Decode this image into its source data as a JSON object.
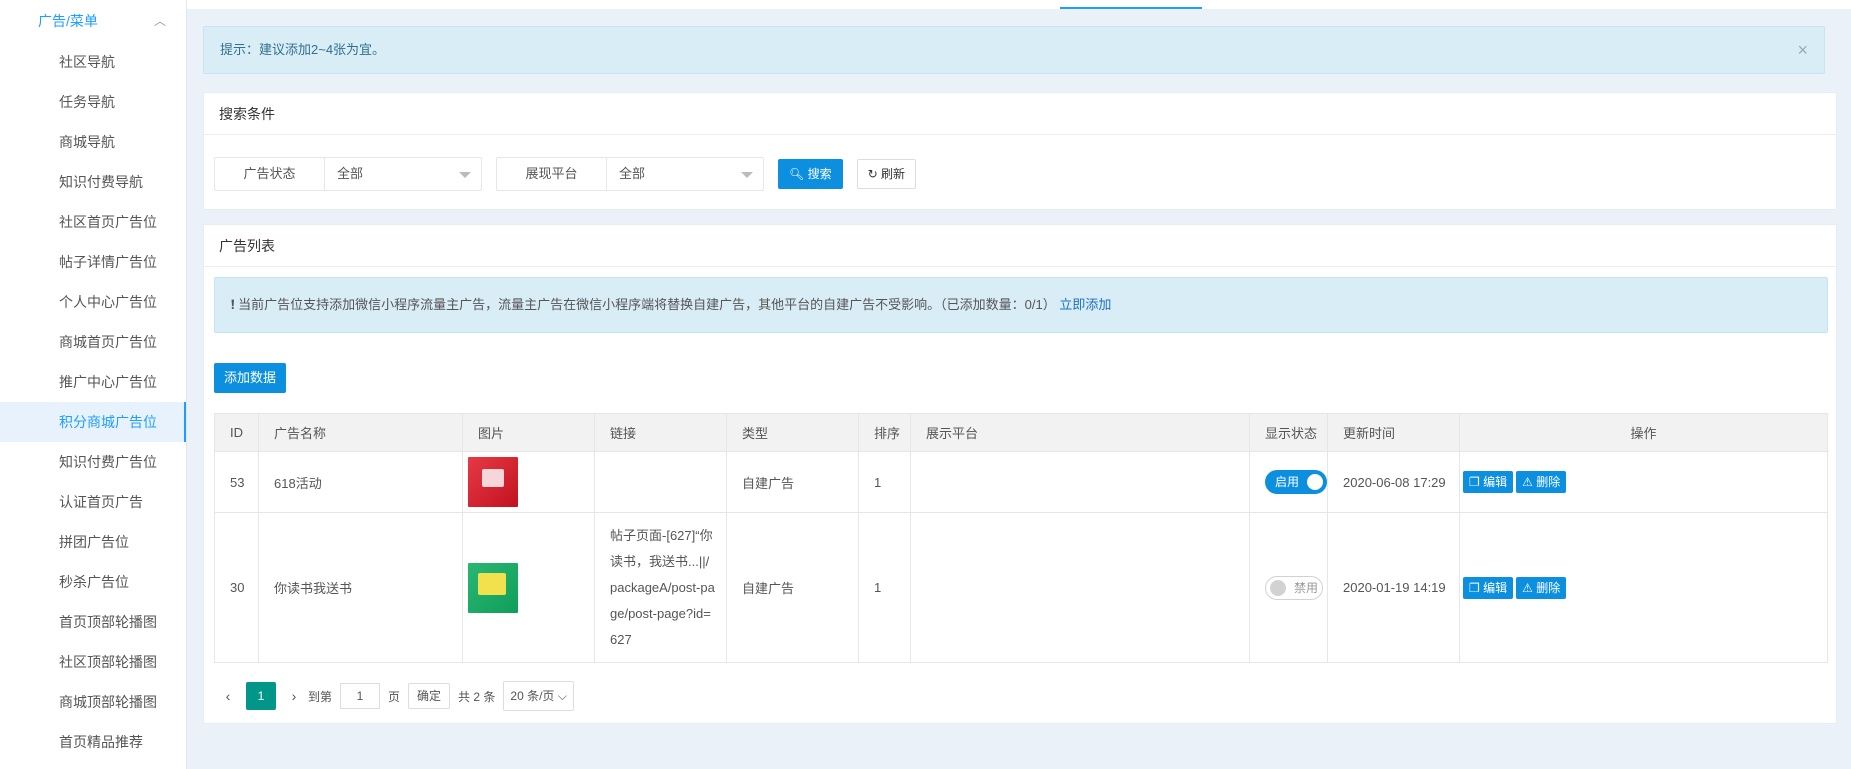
{
  "sidebar": {
    "group_label": "广告/菜单",
    "items": [
      {
        "label": "社区导航"
      },
      {
        "label": "任务导航"
      },
      {
        "label": "商城导航"
      },
      {
        "label": "知识付费导航"
      },
      {
        "label": "社区首页广告位"
      },
      {
        "label": "帖子详情广告位"
      },
      {
        "label": "个人中心广告位"
      },
      {
        "label": "商城首页广告位"
      },
      {
        "label": "推广中心广告位"
      },
      {
        "label": "积分商城广告位"
      },
      {
        "label": "知识付费广告位"
      },
      {
        "label": "认证首页广告"
      },
      {
        "label": "拼团广告位"
      },
      {
        "label": "秒杀广告位"
      },
      {
        "label": "首页顶部轮播图"
      },
      {
        "label": "社区顶部轮播图"
      },
      {
        "label": "商城顶部轮播图"
      },
      {
        "label": "首页精品推荐"
      }
    ]
  },
  "tip": {
    "text": "提示：建议添加2~4张为宜。",
    "close": "×"
  },
  "search": {
    "title": "搜索条件",
    "filters": [
      {
        "label": "广告状态",
        "value": "全部"
      },
      {
        "label": "展现平台",
        "value": "全部"
      }
    ],
    "search_btn": "搜索",
    "refresh_btn": "刷新"
  },
  "list": {
    "title": "广告列表",
    "notice_text": "当前广告位支持添加微信小程序流量主广告，流量主广告在微信小程序端将替换自建广告，其他平台的自建广告不受影响。（已添加数量：0/1）",
    "notice_link": "立即添加",
    "add_btn": "添加数据",
    "columns": [
      "ID",
      "广告名称",
      "图片",
      "链接",
      "类型",
      "排序",
      "展示平台",
      "显示状态",
      "更新时间",
      "操作"
    ],
    "rows": [
      {
        "id": "53",
        "name": "618活动",
        "link": "",
        "type": "自建广告",
        "sort": "1",
        "platform": "",
        "status": "启用",
        "updated": "2020-06-08 17:29"
      },
      {
        "id": "30",
        "name": "你读书我送书",
        "link": "帖子页面-[627]“你读书，我送书...||/packageA/post-page/post-page?id=627",
        "type": "自建广告",
        "sort": "1",
        "platform": "",
        "status": "禁用",
        "updated": "2020-01-19 14:19"
      }
    ],
    "edit_btn": "编辑",
    "delete_btn": "删除"
  },
  "pager": {
    "current": "1",
    "goto_label": "到第",
    "goto_value": "1",
    "page_unit": "页",
    "confirm": "确定",
    "total": "共 2 条",
    "page_size": "20 条/页"
  },
  "colors": {
    "primary": "#0d8fe0",
    "active_page": "#009688",
    "tip_bg": "#d9edf7"
  }
}
